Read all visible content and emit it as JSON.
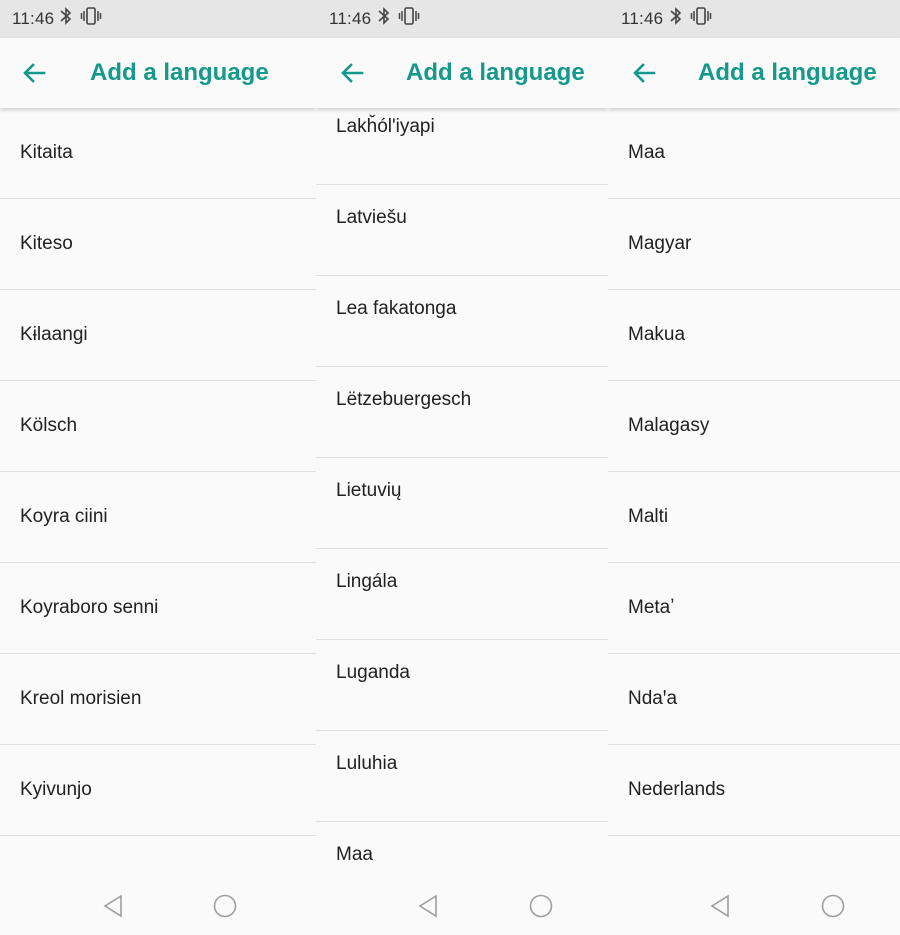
{
  "panels": [
    {
      "status_time": "11:46",
      "title": "Add a language",
      "items": [
        "Kitaita",
        "Kiteso",
        "Kɨlaangi",
        "Kölsch",
        "Koyra ciini",
        "Koyraboro senni",
        "Kreol morisien",
        "Kyivunjo"
      ]
    },
    {
      "status_time": "11:46",
      "title": "Add a language",
      "items": [
        "Lakȟól'iyapi",
        "Latviešu",
        "Lea fakatonga",
        "Lëtzebuergesch",
        "Lietuvių",
        "Lingála",
        "Luganda",
        "Luluhia",
        "Maa"
      ]
    },
    {
      "status_time": "11:46",
      "title": "Add a language",
      "items": [
        "Maa",
        "Magyar",
        "Makua",
        "Malagasy",
        "Malti",
        "Metaʼ",
        "Ndaꞌa",
        "Nederlands"
      ]
    }
  ],
  "colors": {
    "accent": "#14998a",
    "statusbar": "#e6e6e6",
    "text": "#212121"
  },
  "icons": {
    "back": "arrow-left-icon",
    "bluetooth": "bluetooth-icon",
    "vibrate": "vibrate-icon",
    "nav_back": "triangle-back-icon",
    "nav_home": "circle-home-icon"
  }
}
